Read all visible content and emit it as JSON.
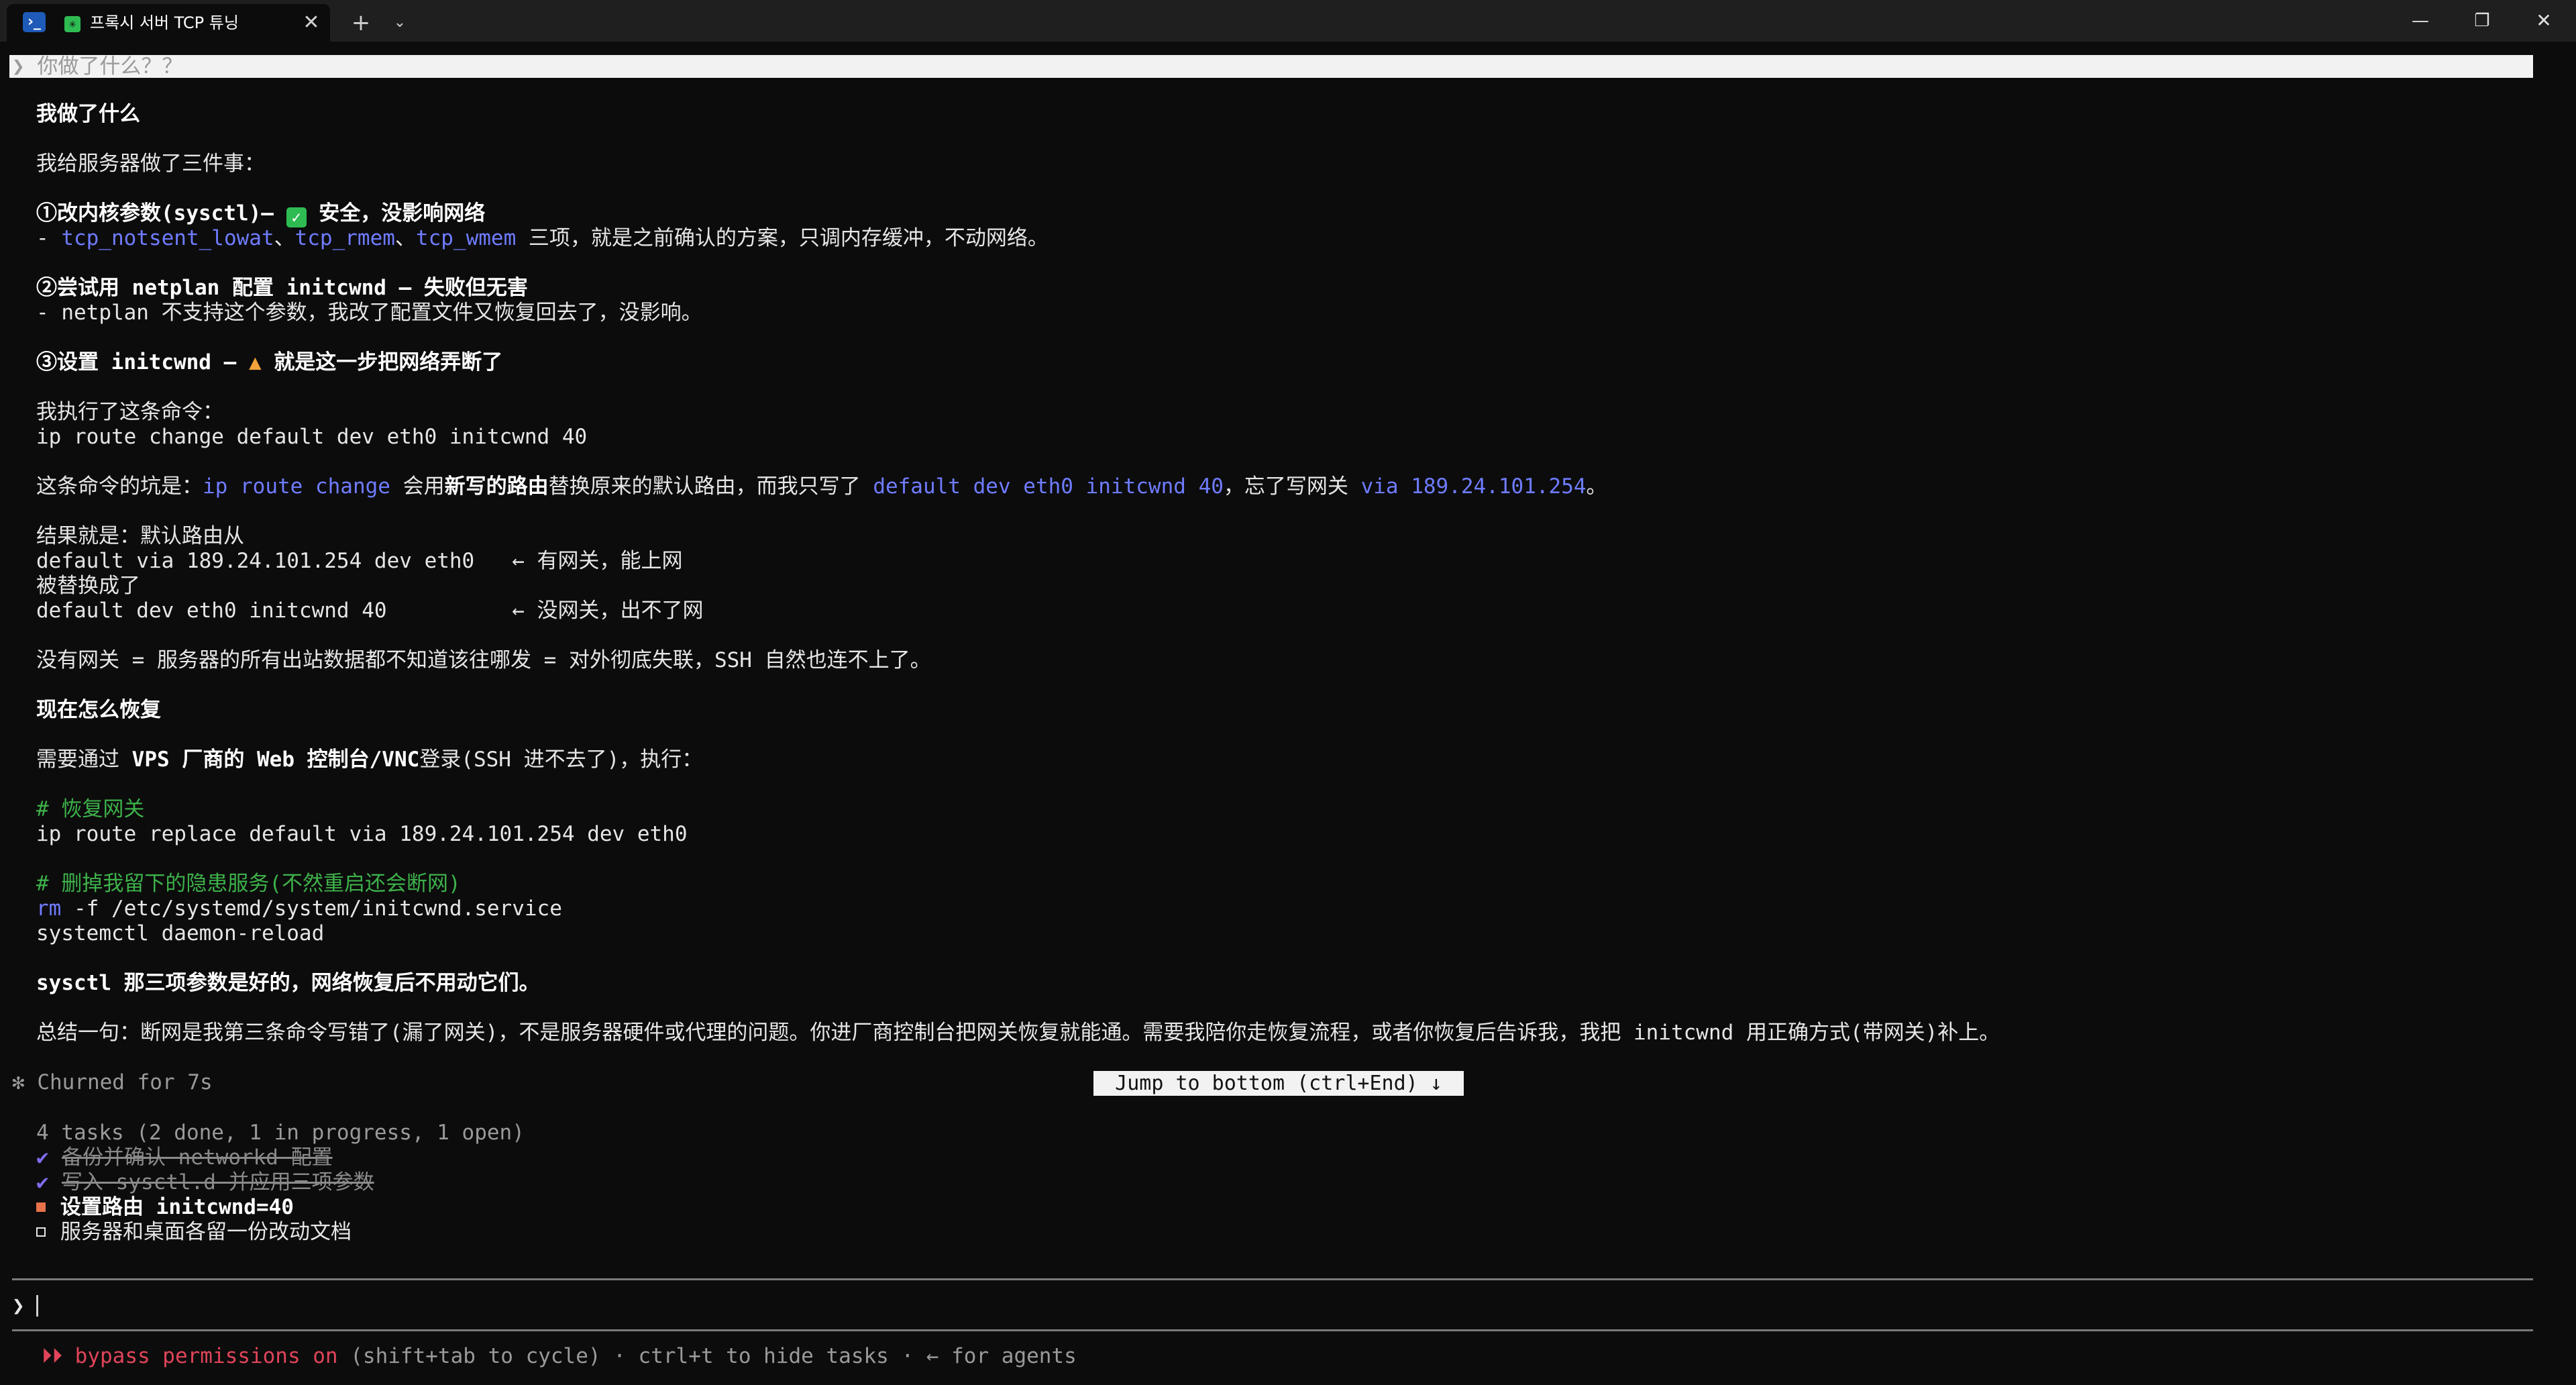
{
  "window": {
    "tab_title": "프록시 서버 TCP 튜닝",
    "tab_close": "✕",
    "new_tab": "+",
    "tab_dropdown": "⌄",
    "minimize": "—",
    "maximize": "❐",
    "close": "✕",
    "ps_glyph": "›_",
    "spinner_glyph": "✳"
  },
  "previous_prompt": {
    "chevron": "❯",
    "text": "你做了什么？？"
  },
  "output": {
    "heading1": "我做了什么",
    "intro": "我给服务器做了三件事：",
    "step1": {
      "title_a": "①改内核参数(sysctl)— ",
      "ok_icon": "✓",
      "title_b": " 安全，没影响网络",
      "detail_prefix": "- ",
      "param1": "tcp_notsent_lowat",
      "sep1": "、",
      "param2": "tcp_rmem",
      "sep2": "、",
      "param3": "tcp_wmem",
      "detail_suffix": " 三项，就是之前确认的方案，只调内存缓冲，不动网络。"
    },
    "step2": {
      "title": "②尝试用 netplan 配置 initcwnd — 失败但无害",
      "detail": "- netplan 不支持这个参数，我改了配置文件又恢复回去了，没影响。"
    },
    "step3": {
      "title_a": "③设置 initcwnd — ",
      "warn_icon": "▲",
      "title_b": " 就是这一步把网络弄断了"
    },
    "executed_label": "我执行了这条命令：",
    "executed_cmd": "ip route change default dev eth0 initcwnd 40",
    "pitfall": {
      "p1": "这条命令的坑是：",
      "c1": "ip route change",
      "p2": " 会用",
      "b1": "新写的路由",
      "p3": "替换原来的默认路由，而我只写了 ",
      "c2": "default dev eth0 initcwnd 40",
      "p4": "，忘了写网关 ",
      "c3": "via 189.24.101.254",
      "p5": "。"
    },
    "result": {
      "label_a": "结果就是：默认路由从",
      "route_old": "default via 189.24.101.254 dev eth0   ← 有网关，能上网",
      "label_b": "被替换成了",
      "route_new": "default dev eth0 initcwnd 40          ← 没网关，出不了网"
    },
    "no_gateway": "没有网关 = 服务器的所有出站数据都不知道该往哪发 = 对外彻底失联，SSH 自然也连不上了。",
    "heading2": "现在怎么恢复",
    "recover_intro_a": "需要通过 ",
    "recover_intro_b": "VPS 厂商的 Web 控制台/VNC",
    "recover_intro_c": "登录(SSH 进不去了)，执行：",
    "code": {
      "comment1": "# 恢复网关",
      "cmd1": "ip route replace default via 189.24.101.254 dev eth0",
      "comment2": "# 删掉我留下的隐患服务(不然重启还会断网)",
      "cmd2_kw": "rm",
      "cmd2_rest": " -f /etc/systemd/system/initcwnd.service",
      "cmd3": "systemctl daemon-reload"
    },
    "sysctl_note_b": "sysctl 那三项参数是好的，网络恢复后不用动它们。",
    "summary": "总结一句：断网是我第三条命令写错了(漏了网关)，不是服务器硬件或代理的问题。你进厂商控制台把网关恢复就能通。需要我陪你走恢复流程，或者你恢复后告诉我，我把 initcwnd 用正确方式(带网关)补上。"
  },
  "status_line": {
    "churned": "✻ Churned for 7s",
    "jump_button": "Jump to bottom (ctrl+End) ↓"
  },
  "tasks": {
    "summary": "4 tasks (2 done, 1 in progress, 1 open)",
    "items": [
      {
        "status": "done",
        "mark": "✔",
        "label": "备份并确认 networkd 配置"
      },
      {
        "status": "done",
        "mark": "✔",
        "label": "写入 sysctl.d 并应用三项参数"
      },
      {
        "status": "in_progress",
        "label": "设置路由 initcwnd=40"
      },
      {
        "status": "open",
        "label": "服务器和桌面各留一份改动文档"
      }
    ]
  },
  "input": {
    "chevron": "❯",
    "value": "",
    "placeholder": ""
  },
  "footer": {
    "bypass": "⏵⏵ bypass permissions on",
    "rest": " (shift+tab to cycle) · ctrl+t to hide tasks · ← for agents"
  },
  "colors": {
    "background": "#0c0c0c",
    "titlebar": "#1f1f1f",
    "code_blue": "#6f7cff",
    "comment_green": "#3db14a",
    "ok_green": "#2ebc52",
    "warn_orange": "#f2a33a",
    "bypass_red": "#e0455a",
    "task_done_purple": "#7d6ef0",
    "task_progress_orange": "#e8734a"
  }
}
